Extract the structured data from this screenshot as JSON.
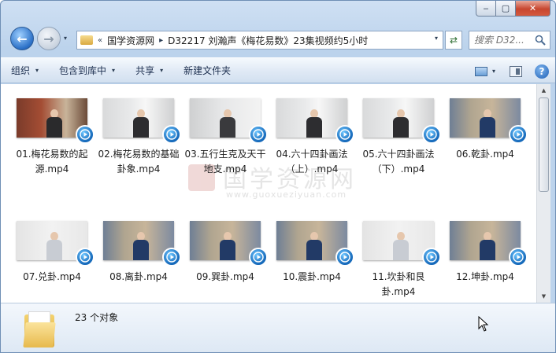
{
  "window": {
    "caption_min_glyph": "‒",
    "caption_max_glyph": "▢",
    "caption_close_glyph": "✕"
  },
  "navigation": {
    "back_glyph": "←",
    "forward_glyph": "→",
    "recent_glyph": "▾",
    "breadcrumb": {
      "overflow": "«",
      "items": [
        "国学资源网",
        "D32217 刘瀚声《梅花易数》23集视频约5小时"
      ],
      "separator": "▸"
    },
    "address_dropdown_glyph": "▾",
    "refresh_glyph": "⇄",
    "search_placeholder": "搜索 D32..."
  },
  "toolbar": {
    "organize": "组织",
    "include_in_library": "包含到库中",
    "share": "共享",
    "new_folder": "新建文件夹",
    "dropdown_glyph": "▾",
    "help_glyph": "?"
  },
  "files": [
    {
      "name": "01.梅花易数的起源.mp4",
      "icon": "video-file",
      "scene": "study"
    },
    {
      "name": "02.梅花易数的基础卦象.mp4",
      "icon": "video-file",
      "scene": "board"
    },
    {
      "name": "03.五行生克及天干地支.mp4",
      "icon": "video-file",
      "scene": "board-light"
    },
    {
      "name": "04.六十四卦画法（上）.mp4",
      "icon": "video-file",
      "scene": "board"
    },
    {
      "name": "05.六十四卦画法（下）.mp4",
      "icon": "video-file",
      "scene": "board"
    },
    {
      "name": "06.乾卦.mp4",
      "icon": "video-file",
      "scene": "library"
    },
    {
      "name": "07.兑卦.mp4",
      "icon": "video-file",
      "scene": "faded"
    },
    {
      "name": "08.离卦.mp4",
      "icon": "video-file",
      "scene": "library"
    },
    {
      "name": "09.巽卦.mp4",
      "icon": "video-file",
      "scene": "library"
    },
    {
      "name": "10.震卦.mp4",
      "icon": "video-file",
      "scene": "library"
    },
    {
      "name": "11.坎卦和艮卦.mp4",
      "icon": "video-file",
      "scene": "faded"
    },
    {
      "name": "12.坤卦.mp4",
      "icon": "video-file",
      "scene": "library"
    }
  ],
  "watermark": {
    "text": "国学资源网",
    "url": "www.guoxueziyuan.com"
  },
  "scrollbar": {
    "up_glyph": "▲",
    "down_glyph": "▼"
  },
  "status": {
    "item_count": "23 个对象"
  },
  "colors": {
    "chrome_blue": "#bcd3ec",
    "command_bar": "#dfe9f5",
    "badge_blue": "#1367b9",
    "close_red": "#c7462f"
  }
}
